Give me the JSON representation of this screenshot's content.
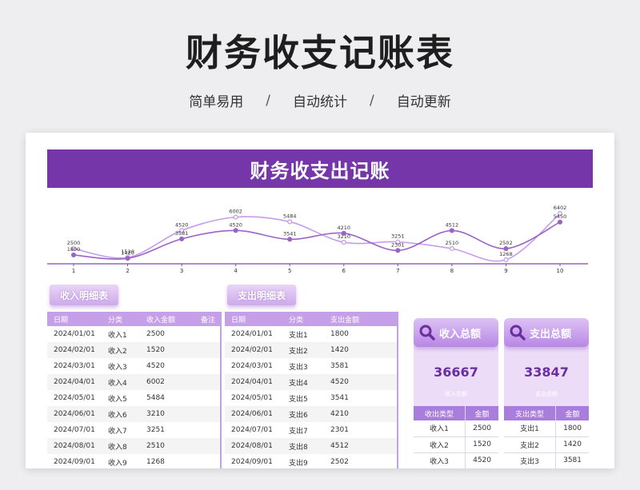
{
  "hero": {
    "title": "财务收支记账表",
    "tags": [
      "简单易用",
      "自动统计",
      "自动更新"
    ],
    "separator": "/"
  },
  "sheet": {
    "banner_title": "财务收支出记账"
  },
  "chart_data": {
    "type": "line",
    "x": [
      1,
      2,
      3,
      4,
      5,
      6,
      7,
      8,
      9,
      10
    ],
    "series": [
      {
        "values": [
          2500,
          1520,
          4520,
          6002,
          5484,
          3210,
          3251,
          2510,
          1268,
          6402
        ],
        "color": "#c79cec"
      },
      {
        "values": [
          1800,
          1420,
          3581,
          4520,
          3541,
          4210,
          2301,
          4512,
          2502,
          5450
        ],
        "color": "#9a64c6"
      }
    ],
    "grid": false
  },
  "income": {
    "title": "收入明细表",
    "headers": [
      "日期",
      "分类",
      "收入金额",
      "备注"
    ],
    "rows": [
      [
        "2024/01/01",
        "收入1",
        "2500",
        ""
      ],
      [
        "2024/02/01",
        "收入2",
        "1520",
        ""
      ],
      [
        "2024/03/01",
        "收入3",
        "4520",
        ""
      ],
      [
        "2024/04/01",
        "收入4",
        "6002",
        ""
      ],
      [
        "2024/05/01",
        "收入5",
        "5484",
        ""
      ],
      [
        "2024/06/01",
        "收入6",
        "3210",
        ""
      ],
      [
        "2024/07/01",
        "收入7",
        "3251",
        ""
      ],
      [
        "2024/08/01",
        "收入8",
        "2510",
        ""
      ],
      [
        "2024/09/01",
        "收入9",
        "1268",
        ""
      ]
    ]
  },
  "expense": {
    "title": "支出明细表",
    "headers": [
      "日期",
      "分类",
      "支出金额"
    ],
    "rows": [
      [
        "2024/01/01",
        "支出1",
        "1800"
      ],
      [
        "2024/02/01",
        "支出2",
        "1420"
      ],
      [
        "2024/03/01",
        "支出3",
        "3581"
      ],
      [
        "2024/04/01",
        "支出4",
        "4520"
      ],
      [
        "2024/05/01",
        "支出5",
        "3541"
      ],
      [
        "2024/06/01",
        "支出6",
        "4210"
      ],
      [
        "2024/07/01",
        "支出7",
        "2301"
      ],
      [
        "2024/08/01",
        "支出8",
        "4512"
      ],
      [
        "2024/09/01",
        "支出9",
        "2502"
      ]
    ]
  },
  "income_summary": {
    "title": "收入总额",
    "total": "36667",
    "caption": "收入总额",
    "headers": [
      "收出类型",
      "金额"
    ],
    "rows": [
      [
        "收入1",
        "2500"
      ],
      [
        "收入2",
        "1520"
      ],
      [
        "收入3",
        "4520"
      ]
    ]
  },
  "expense_summary": {
    "title": "支出总额",
    "total": "33847",
    "caption": "支出总额",
    "headers": [
      "支出类型",
      "金额"
    ],
    "rows": [
      [
        "支出1",
        "1800"
      ],
      [
        "支出2",
        "1420"
      ],
      [
        "支出3",
        "3581"
      ]
    ]
  },
  "icons": {
    "card_icon": "search-icon"
  }
}
